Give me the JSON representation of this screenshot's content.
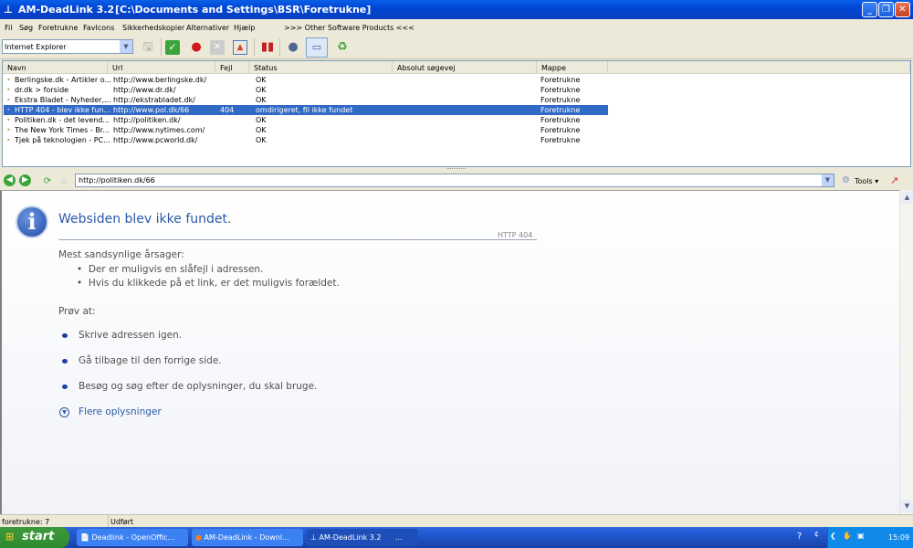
{
  "window": {
    "app": "AM-DeadLink 3.2",
    "path": "[C:\\Documents and Settings\\BSR\\Foretrukne]"
  },
  "menu": [
    "Fil",
    "Søg",
    "Foretrukne",
    "FavIcons",
    "Sikkerhedskopier",
    "Alternativer",
    "Hjælp",
    ">>> Other Software Products <<<"
  ],
  "toolbar": {
    "browser_select": "Internet Explorer"
  },
  "list": {
    "columns": [
      "Navn",
      "Url",
      "Fejl",
      "Status",
      "Absolut søgevej",
      "Mappe"
    ],
    "rows": [
      {
        "name": "Berlingske.dk - Artikler o...",
        "url": "http://www.berlingske.dk/",
        "error": "",
        "status": "OK",
        "path": "",
        "folder": "Foretrukne"
      },
      {
        "name": "dr.dk > forside",
        "url": "http://www.dr.dk/",
        "error": "",
        "status": "OK",
        "path": "",
        "folder": "Foretrukne"
      },
      {
        "name": "Ekstra Bladet - Nyheder,...",
        "url": "http://ekstrabladet.dk/",
        "error": "",
        "status": "OK",
        "path": "",
        "folder": "Foretrukne"
      },
      {
        "name": "HTTP 404 - blev ikke fun...",
        "url": "http://www.pol.dk/66",
        "error": "404",
        "status": "omdirigeret, fil ikke fundet",
        "path": "",
        "folder": "Foretrukne",
        "selected": true
      },
      {
        "name": "Politiken.dk - det levend...",
        "url": "http://politiken.dk/",
        "error": "",
        "status": "OK",
        "path": "",
        "folder": "Foretrukne"
      },
      {
        "name": "The New York Times - Br...",
        "url": "http://www.nytimes.com/",
        "error": "",
        "status": "OK",
        "path": "",
        "folder": "Foretrukne"
      },
      {
        "name": "Tjek på teknologien - PC...",
        "url": "http://www.pcworld.dk/",
        "error": "",
        "status": "OK",
        "path": "",
        "folder": "Foretrukne"
      }
    ]
  },
  "browser": {
    "address": "http://politiken.dk/66",
    "tools_label": "Tools"
  },
  "page": {
    "title": "Websiden blev ikke fundet.",
    "code": "HTTP 404",
    "causes_heading": "Mest sandsynlige årsager:",
    "causes": [
      "Der er muligvis en slåfejl i adressen.",
      "Hvis du klikkede på et link, er det muligvis forældet."
    ],
    "try_heading": "Prøv at:",
    "try_items": [
      "Skrive adressen igen.",
      "Gå tilbage til den forrige side.",
      "Besøg  og søg efter de oplysninger, du skal bruge."
    ],
    "more_info": "Flere oplysninger"
  },
  "status": {
    "count": "foretrukne: 7",
    "state": "Udført"
  },
  "taskbar": {
    "start": "start",
    "tasks": [
      "Deadlink - OpenOffic...",
      "AM-DeadLink - Downl...",
      "AM-DeadLink 3.2"
    ],
    "extra": "...",
    "clock": "15:09"
  },
  "colors": {
    "selection": "#316ac5",
    "title": "#0046d5",
    "heading": "#2a5aa8"
  }
}
